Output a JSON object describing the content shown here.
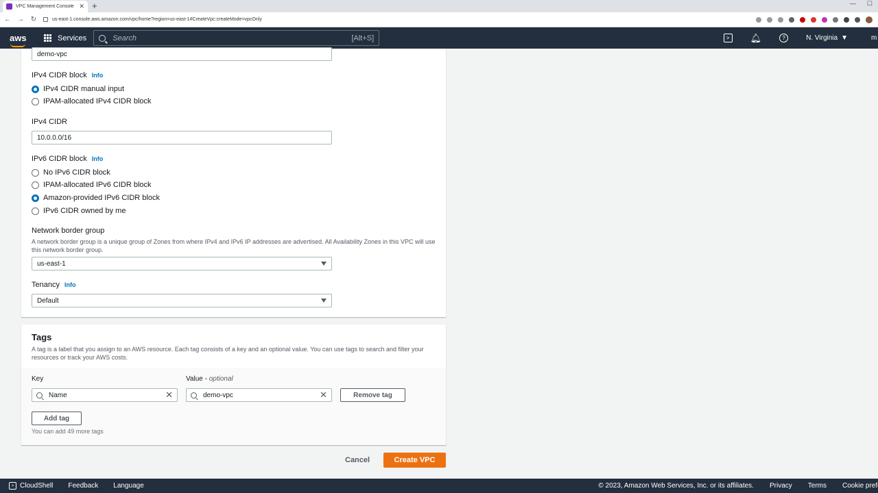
{
  "browser": {
    "tab_title": "VPC Management Console",
    "url": "us-east-1.console.aws.amazon.com/vpc/home?region=us-east-1#CreateVpc:createMode=vpcOnly"
  },
  "header": {
    "logo": "aws",
    "services_label": "Services",
    "search_placeholder": "Search",
    "search_shortcut": "[Alt+S]",
    "region": "N. Virginia",
    "account_initial": "m"
  },
  "form": {
    "name_value": "demo-vpc",
    "ipv4_block_label": "IPv4 CIDR block",
    "info": "Info",
    "ipv4_options": [
      "IPv4 CIDR manual input",
      "IPAM-allocated IPv4 CIDR block"
    ],
    "ipv4_cidr_label": "IPv4 CIDR",
    "ipv4_cidr_value": "10.0.0.0/16",
    "ipv6_block_label": "IPv6 CIDR block",
    "ipv6_options": [
      "No IPv6 CIDR block",
      "IPAM-allocated IPv6 CIDR block",
      "Amazon-provided IPv6 CIDR block",
      "IPv6 CIDR owned by me"
    ],
    "nbg_label": "Network border group",
    "nbg_desc": "A network border group is a unique group of Zones from where IPv4 and IPv6 IP addresses are advertised. All Availability Zones in this VPC will use this network border group.",
    "nbg_value": "us-east-1",
    "tenancy_label": "Tenancy",
    "tenancy_value": "Default"
  },
  "tags": {
    "title": "Tags",
    "desc": "A tag is a label that you assign to an AWS resource. Each tag consists of a key and an optional value. You can use tags to search and filter your resources or track your AWS costs.",
    "key_label": "Key",
    "value_label": "Value",
    "value_optional": "optional",
    "key_value": "Name",
    "value_value": "demo-vpc",
    "remove_label": "Remove tag",
    "add_label": "Add tag",
    "note": "You can add 49 more tags"
  },
  "actions": {
    "cancel": "Cancel",
    "create": "Create VPC"
  },
  "footer": {
    "cloudshell": "CloudShell",
    "feedback": "Feedback",
    "language": "Language",
    "copyright": "© 2023, Amazon Web Services, Inc. or its affiliates.",
    "privacy": "Privacy",
    "terms": "Terms",
    "cookie": "Cookie preferences"
  }
}
